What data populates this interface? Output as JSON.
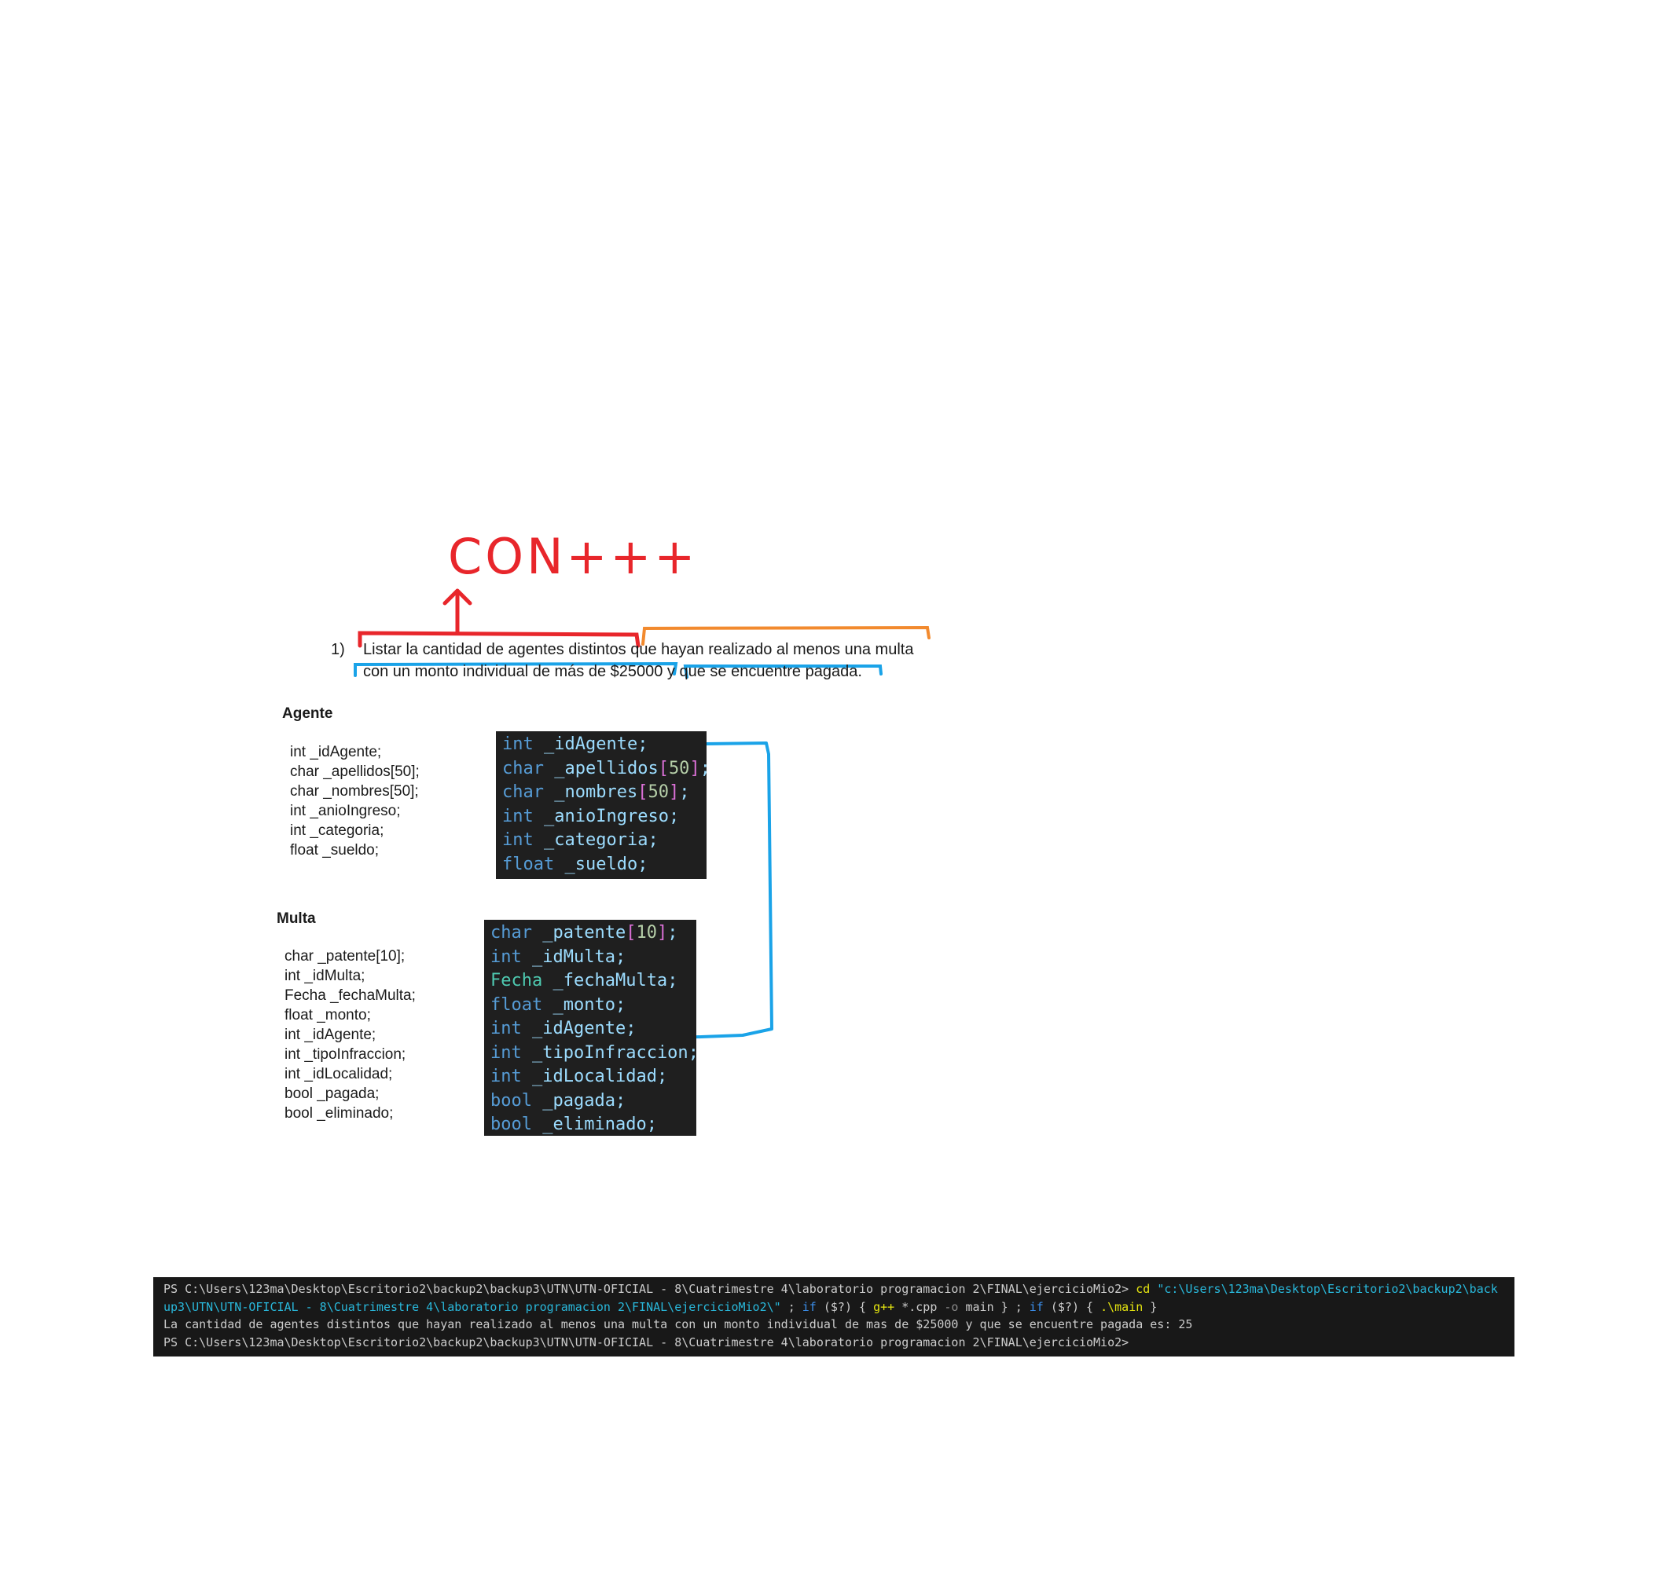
{
  "annotation": {
    "handwritten_label": "CON+++",
    "colors": {
      "red": "#e8262b",
      "orange": "#f28a2e",
      "blue": "#1aa3e8"
    }
  },
  "exercise": {
    "number": "1)",
    "line1": "Listar la cantidad de agentes distintos que hayan realizado al menos una multa",
    "line2": "con un monto individual de más de $25000 y que se encuentre pagada."
  },
  "agente": {
    "title": "Agente",
    "fields": [
      "int _idAgente;",
      "char _apellidos[50];",
      "char _nombres[50];",
      "int _anioIngreso;",
      "int _categoria;",
      "float _sueldo;"
    ],
    "code": [
      {
        "type": "int",
        "name": "_idAgente",
        "idx": "",
        "end": ";"
      },
      {
        "type": "char",
        "name": "_apellidos",
        "idx": "50",
        "end": ";"
      },
      {
        "type": "char",
        "name": "_nombres",
        "idx": "50",
        "end": ";"
      },
      {
        "type": "int",
        "name": "_anioIngreso",
        "idx": "",
        "end": ";"
      },
      {
        "type": "int",
        "name": "_categoria",
        "idx": "",
        "end": ";"
      },
      {
        "type": "float",
        "name": "_sueldo",
        "idx": "",
        "end": ";"
      }
    ]
  },
  "multa": {
    "title": "Multa",
    "fields": [
      "char _patente[10];",
      "int _idMulta;",
      "Fecha _fechaMulta;",
      "float _monto;",
      "int _idAgente;",
      "int _tipoInfraccion;",
      "int _idLocalidad;",
      "bool _pagada;",
      "bool _eliminado;"
    ],
    "code": [
      {
        "type": "char",
        "name": "_patente",
        "idx": "10",
        "end": ";"
      },
      {
        "type": "int",
        "name": "_idMulta",
        "idx": "",
        "end": ";"
      },
      {
        "type": "Fecha",
        "name": "_fechaMulta",
        "idx": "",
        "end": ";"
      },
      {
        "type": "float",
        "name": "_monto",
        "idx": "",
        "end": ";"
      },
      {
        "type": "int",
        "name": "_idAgente",
        "idx": "",
        "end": ";"
      },
      {
        "type": "int",
        "name": "_tipoInfraccion",
        "idx": "",
        "end": ";"
      },
      {
        "type": "int",
        "name": "_idLocalidad",
        "idx": "",
        "end": ";"
      },
      {
        "type": "bool",
        "name": "_pagada",
        "idx": "",
        "end": ";"
      },
      {
        "type": "bool",
        "name": "_eliminado",
        "idx": "",
        "end": ";"
      }
    ]
  },
  "terminal": {
    "prompt1": "PS C:\\Users\\123ma\\Desktop\\Escritorio2\\backup2\\backup3\\UTN\\UTN-OFICIAL - 8\\Cuatrimestre 4\\laboratorio programacion 2\\FINAL\\ejercicioMio2> ",
    "cmd_cd": "cd",
    "path_part1": "\"c:\\Users\\123ma\\Desktop\\Escritorio2\\backup2\\back",
    "path_part2": "up3\\UTN\\UTN-OFICIAL - 8\\Cuatrimestre 4\\laboratorio programacion 2\\FINAL\\ejercicioMio2\\\"",
    "sep1": " ; ",
    "if1": "if",
    "cond1": " ($?) ",
    "brace_open1": "{ ",
    "gpp": "g++",
    "gpp_args": " *.cpp ",
    "flag_o": "-o",
    "gpp_out": " main } ; ",
    "if2": "if",
    "cond2": " ($?) ",
    "brace_open2": "{ ",
    "run": ".\\main",
    "brace_close2": " }",
    "output": "La cantidad de agentes distintos que hayan realizado al menos una multa con un monto individual de mas de $25000 y que se encuentre pagada es: 25",
    "prompt2": "PS C:\\Users\\123ma\\Desktop\\Escritorio2\\backup2\\backup3\\UTN\\UTN-OFICIAL - 8\\Cuatrimestre 4\\laboratorio programacion 2\\FINAL\\ejercicioMio2>"
  }
}
